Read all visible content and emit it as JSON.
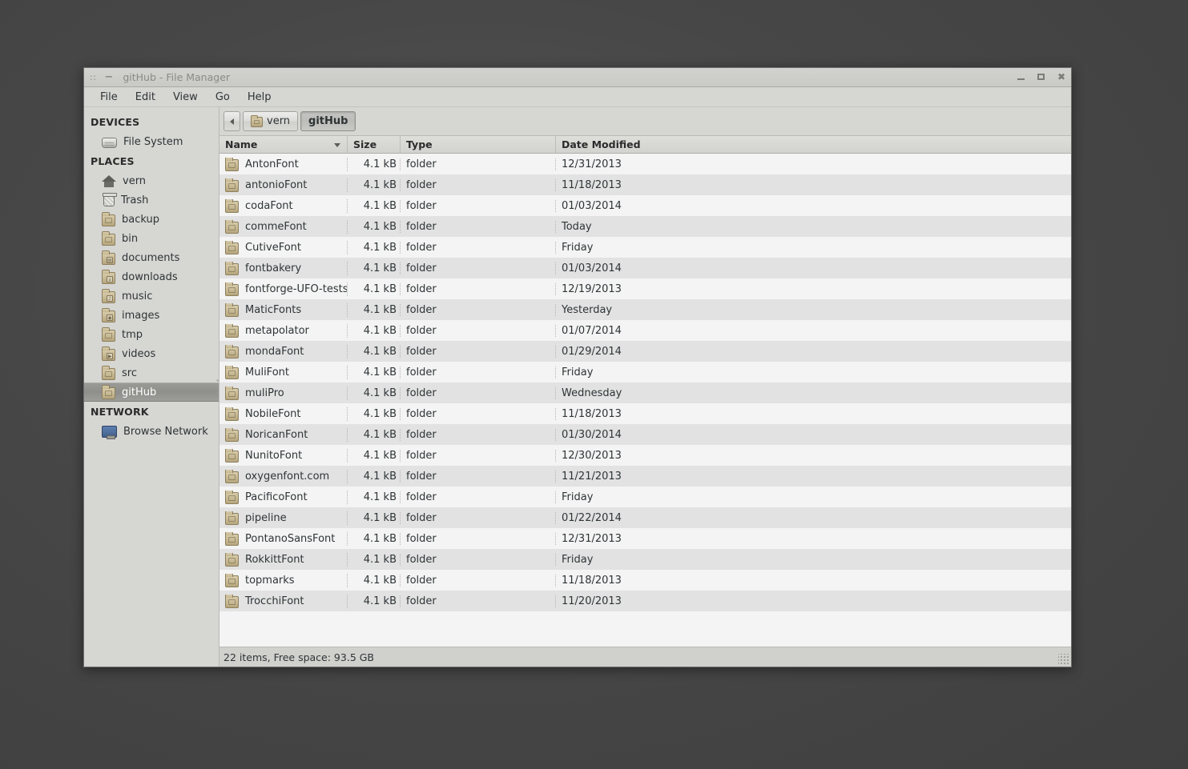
{
  "window": {
    "title": "gitHub - File Manager",
    "dots_glyph": "::",
    "dash_glyph": "−",
    "close_glyph": "✖",
    "controls": {
      "minimize": "minimize",
      "maximize": "maximize",
      "close": "close"
    }
  },
  "menubar": {
    "items": [
      "File",
      "Edit",
      "View",
      "Go",
      "Help"
    ]
  },
  "sidebar": {
    "sections": [
      {
        "heading": "DEVICES",
        "items": [
          {
            "label": "File System",
            "icon": "disk-icon",
            "selected": false
          }
        ]
      },
      {
        "heading": "PLACES",
        "items": [
          {
            "label": "vern",
            "icon": "home-icon",
            "selected": false
          },
          {
            "label": "Trash",
            "icon": "trash-icon",
            "selected": false
          },
          {
            "label": "backup",
            "icon": "folder-icon",
            "selected": false
          },
          {
            "label": "bin",
            "icon": "folder-icon",
            "selected": false
          },
          {
            "label": "documents",
            "icon": "folder-documents-icon",
            "selected": false
          },
          {
            "label": "downloads",
            "icon": "folder-downloads-icon",
            "selected": false
          },
          {
            "label": "music",
            "icon": "folder-music-icon",
            "selected": false
          },
          {
            "label": "images",
            "icon": "folder-images-icon",
            "selected": false
          },
          {
            "label": "tmp",
            "icon": "folder-icon",
            "selected": false
          },
          {
            "label": "videos",
            "icon": "folder-videos-icon",
            "selected": false
          },
          {
            "label": "src",
            "icon": "folder-icon",
            "selected": false
          },
          {
            "label": "gitHub",
            "icon": "folder-icon",
            "selected": true
          }
        ]
      },
      {
        "heading": "NETWORK",
        "items": [
          {
            "label": "Browse Network",
            "icon": "network-icon",
            "selected": false
          }
        ]
      }
    ]
  },
  "pathbar": {
    "back_label": "",
    "crumbs": [
      {
        "label": "vern",
        "icon": "home-folder-icon",
        "active": false
      },
      {
        "label": "gitHub",
        "icon": "",
        "active": true
      }
    ]
  },
  "columns": [
    {
      "label": "Name",
      "sorted": true,
      "sort_dir": "descending"
    },
    {
      "label": "Size",
      "sorted": false
    },
    {
      "label": "Type",
      "sorted": false
    },
    {
      "label": "Date Modified",
      "sorted": false
    }
  ],
  "files": [
    {
      "name": "AntonFont",
      "size": "4.1 kB",
      "type": "folder",
      "date": "12/31/2013"
    },
    {
      "name": "antonioFont",
      "size": "4.1 kB",
      "type": "folder",
      "date": "11/18/2013"
    },
    {
      "name": "codaFont",
      "size": "4.1 kB",
      "type": "folder",
      "date": "01/03/2014"
    },
    {
      "name": "commeFont",
      "size": "4.1 kB",
      "type": "folder",
      "date": "Today"
    },
    {
      "name": "CutiveFont",
      "size": "4.1 kB",
      "type": "folder",
      "date": "Friday"
    },
    {
      "name": "fontbakery",
      "size": "4.1 kB",
      "type": "folder",
      "date": "01/03/2014"
    },
    {
      "name": "fontforge-UFO-tests",
      "size": "4.1 kB",
      "type": "folder",
      "date": "12/19/2013"
    },
    {
      "name": "MaticFonts",
      "size": "4.1 kB",
      "type": "folder",
      "date": "Yesterday"
    },
    {
      "name": "metapolator",
      "size": "4.1 kB",
      "type": "folder",
      "date": "01/07/2014"
    },
    {
      "name": "mondaFont",
      "size": "4.1 kB",
      "type": "folder",
      "date": "01/29/2014"
    },
    {
      "name": "MuliFont",
      "size": "4.1 kB",
      "type": "folder",
      "date": "Friday"
    },
    {
      "name": "muliPro",
      "size": "4.1 kB",
      "type": "folder",
      "date": "Wednesday"
    },
    {
      "name": "NobileFont",
      "size": "4.1 kB",
      "type": "folder",
      "date": "11/18/2013"
    },
    {
      "name": "NoricanFont",
      "size": "4.1 kB",
      "type": "folder",
      "date": "01/30/2014"
    },
    {
      "name": "NunitoFont",
      "size": "4.1 kB",
      "type": "folder",
      "date": "12/30/2013"
    },
    {
      "name": "oxygenfont.com",
      "size": "4.1 kB",
      "type": "folder",
      "date": "11/21/2013"
    },
    {
      "name": "PacificoFont",
      "size": "4.1 kB",
      "type": "folder",
      "date": "Friday"
    },
    {
      "name": "pipeline",
      "size": "4.1 kB",
      "type": "folder",
      "date": "01/22/2014"
    },
    {
      "name": "PontanoSansFont",
      "size": "4.1 kB",
      "type": "folder",
      "date": "12/31/2013"
    },
    {
      "name": "RokkittFont",
      "size": "4.1 kB",
      "type": "folder",
      "date": "Friday"
    },
    {
      "name": "topmarks",
      "size": "4.1 kB",
      "type": "folder",
      "date": "11/18/2013"
    },
    {
      "name": "TrocchiFont",
      "size": "4.1 kB",
      "type": "folder",
      "date": "11/20/2013"
    }
  ],
  "statusbar": {
    "text": "22 items, Free space: 93.5 GB"
  },
  "colors": {
    "desktop": "#474747",
    "window_chrome": "#d6d6d3",
    "row_odd": "#f4f4f4",
    "row_even": "#e2e2e2",
    "selection": "#929290",
    "text": "#2e3436",
    "folder_icon": "#c6b893"
  },
  "layout": {
    "column_widths": {
      "name": 160,
      "size": 66,
      "type": 194,
      "date": 320
    }
  }
}
